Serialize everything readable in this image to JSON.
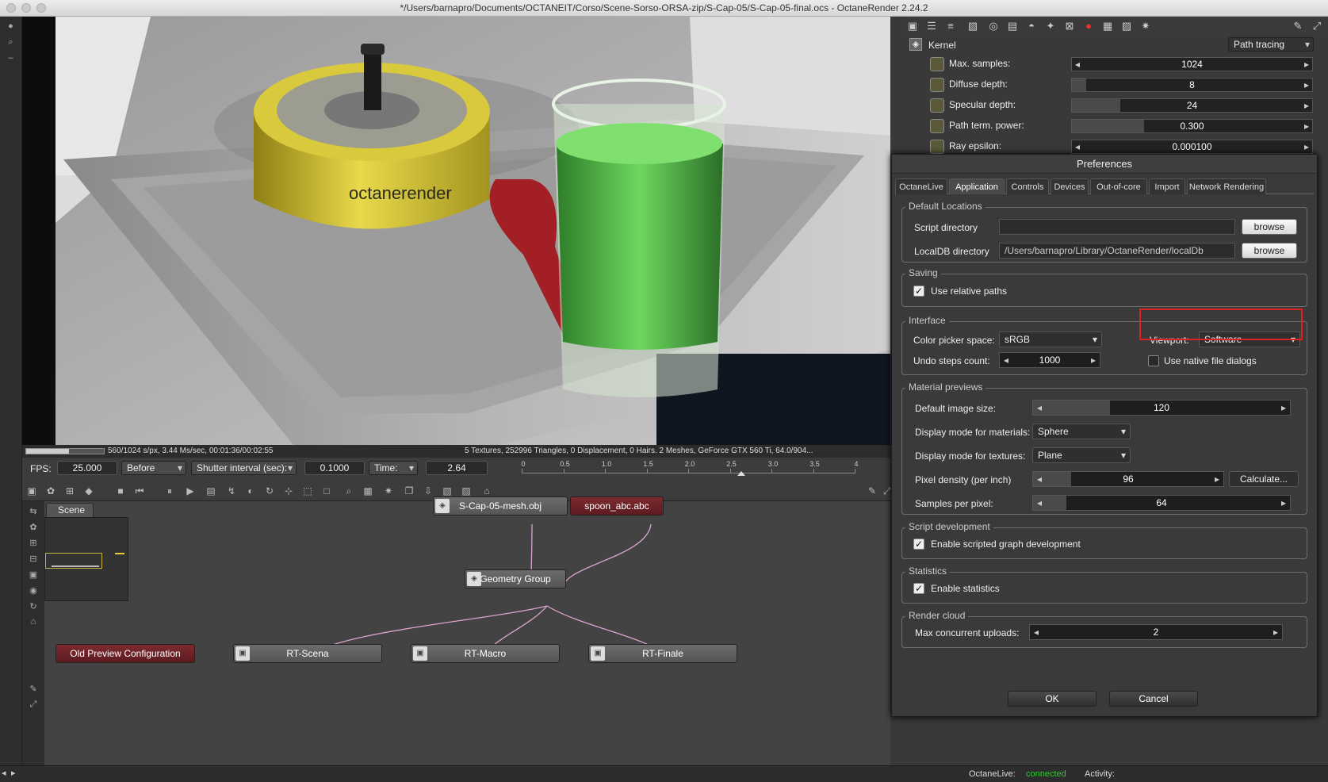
{
  "window": {
    "title": "*/Users/barnapro/Documents/OCTANEIT/Corso/Scene-Sorso-ORSA-zip/S-Cap-05/S-Cap-05-final.ocs - OctaneRender 2.24.2"
  },
  "render": {
    "progress": 0.547,
    "status_left": "560/1024 s/px, 3.44 Ms/sec, 00:01:36/00:02:55",
    "status_right": "5 Textures, 252996 Triangles, 0 Displacement, 0 Hairs. 2 Meshes, GeForce GTX 560 Ti, 64.0/904...",
    "scene_text": "octanerender"
  },
  "animation": {
    "fps_label": "FPS:",
    "fps_value": "25.000",
    "mode": "Before",
    "shutter_label": "Shutter interval (sec):",
    "shutter_value": "0.1000",
    "time_label": "Time:",
    "time_value": "2.64",
    "ticks": [
      "0",
      "0.5",
      "1.0",
      "1.5",
      "2.0",
      "2.5",
      "3.0",
      "3.5",
      "4"
    ],
    "playhead_time": 2.64
  },
  "nodegraph": {
    "tab": "Scene",
    "nodes": {
      "mesh": "S-Cap-05-mesh.obj",
      "spoon": "spoon_abc.abc",
      "group": "Geometry Group",
      "old_preview": "Old Preview Configuration",
      "rt_scena": "RT-Scena",
      "rt_macro": "RT-Macro",
      "rt_finale": "RT-Finale"
    }
  },
  "kernel": {
    "title": "Kernel",
    "type": "Path tracing",
    "params": [
      {
        "label": "Max. samples:",
        "value": "1024",
        "fill": 0.0
      },
      {
        "label": "Diffuse depth:",
        "value": "8",
        "fill": 0.06
      },
      {
        "label": "Specular depth:",
        "value": "24",
        "fill": 0.2
      },
      {
        "label": "Path term. power:",
        "value": "0.300",
        "fill": 0.3
      },
      {
        "label": "Ray epsilon:",
        "value": "0.000100",
        "fill": 0.0
      }
    ]
  },
  "prefs": {
    "title": "Preferences",
    "tabs": [
      "OctaneLive",
      "Application",
      "Controls",
      "Devices",
      "Out-of-core",
      "Import",
      "Network Rendering"
    ],
    "active_tab": "Application",
    "default_locations": {
      "title": "Default Locations",
      "script_label": "Script directory",
      "script_value": "",
      "localdb_label": "LocalDB directory",
      "localdb_value": "/Users/barnapro/Library/OctaneRender/localDb",
      "browse": "browse"
    },
    "saving": {
      "title": "Saving",
      "relative": "Use relative paths"
    },
    "interface": {
      "title": "Interface",
      "color_label": "Color picker space:",
      "color_value": "sRGB",
      "viewport_label": "Viewport:",
      "viewport_value": "Software",
      "undo_label": "Undo steps count:",
      "undo_value": "1000",
      "native": "Use native file dialogs"
    },
    "material": {
      "title": "Material previews",
      "size_label": "Default image size:",
      "size_value": "120",
      "size_fill": 0.3,
      "mat_label": "Display mode for materials:",
      "mat_value": "Sphere",
      "tex_label": "Display mode for textures:",
      "tex_value": "Plane",
      "density_label": "Pixel density (per inch)",
      "density_value": "96",
      "density_fill": 0.2,
      "calc": "Calculate...",
      "spp_label": "Samples per pixel:",
      "spp_value": "64",
      "spp_fill": 0.13
    },
    "script": {
      "title": "Script development",
      "enable": "Enable scripted graph development"
    },
    "statistics": {
      "title": "Statistics",
      "enable": "Enable statistics"
    },
    "cloud": {
      "title": "Render cloud",
      "label": "Max concurrent uploads:",
      "value": "2"
    },
    "ok": "OK",
    "cancel": "Cancel"
  },
  "footer": {
    "live_label": "OctaneLive:",
    "live_status": "connected",
    "activity_label": "Activity:"
  },
  "colors": {
    "connected": "#2ecc2e",
    "highlight": "#e02020",
    "node": "#7a6274",
    "node_dark": "#6e2228"
  }
}
